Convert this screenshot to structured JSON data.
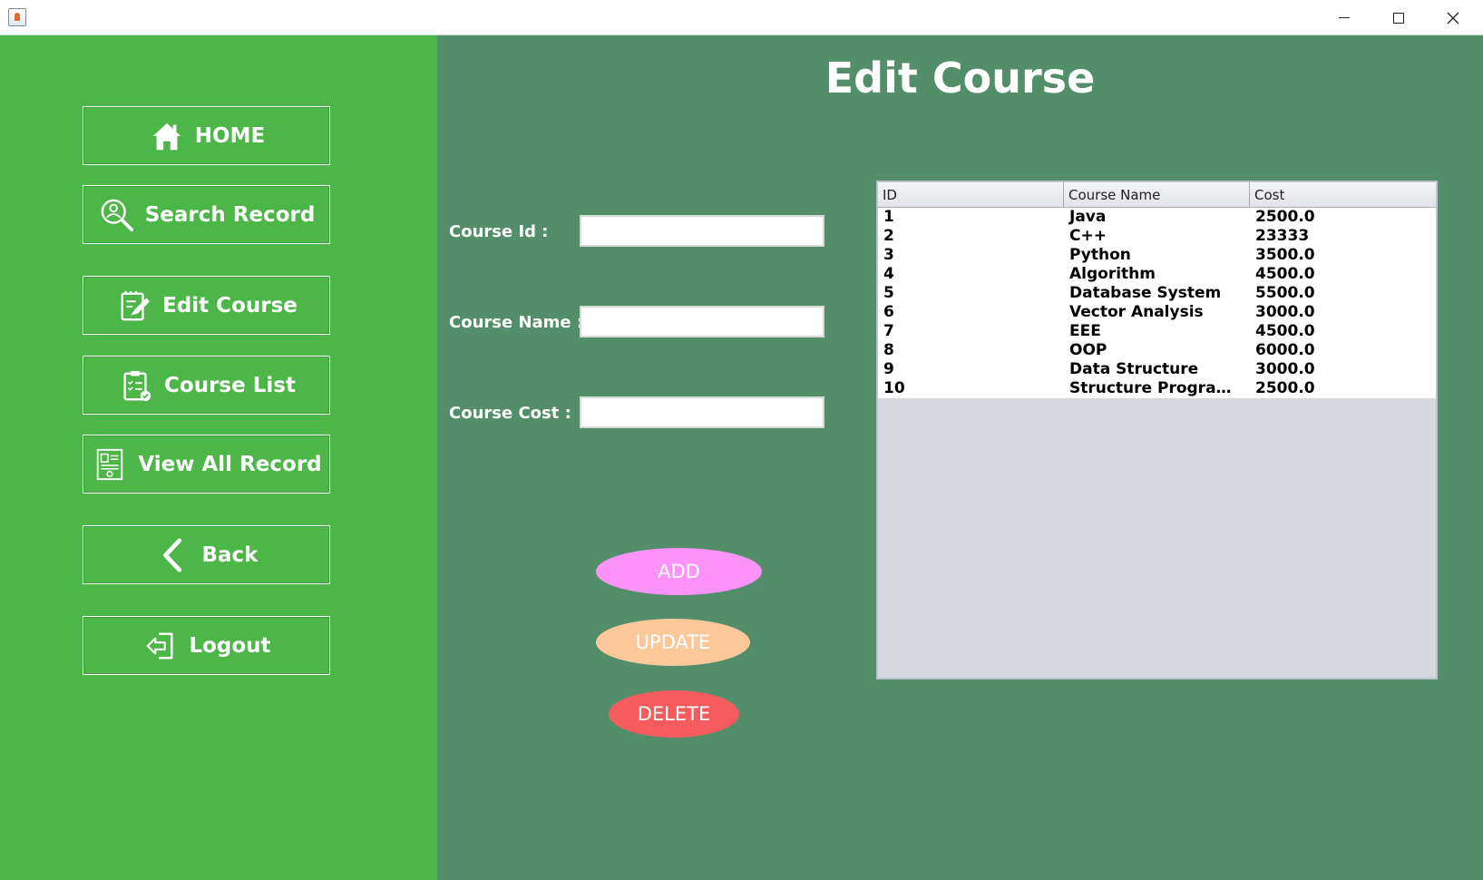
{
  "window": {
    "title": "",
    "icons": {
      "app": "java-app-icon",
      "minimize": "minimize-icon",
      "maximize": "maximize-icon",
      "close": "close-icon"
    }
  },
  "sidebar": {
    "background": "#4db648",
    "items": [
      {
        "label": "HOME",
        "icon": "home-icon"
      },
      {
        "label": "Search Record",
        "icon": "search-user-icon"
      },
      {
        "label": "Edit Course",
        "icon": "edit-document-icon"
      },
      {
        "label": "Course List",
        "icon": "checklist-icon"
      },
      {
        "label": "View All Record",
        "icon": "record-certificate-icon"
      },
      {
        "label": "Back",
        "icon": "chevron-left-icon"
      },
      {
        "label": "Logout",
        "icon": "logout-icon"
      }
    ]
  },
  "main": {
    "background": "#518e69",
    "title": "Edit Course",
    "form": {
      "course_id": {
        "label": "Course Id :",
        "value": ""
      },
      "course_name": {
        "label": "Course Name :",
        "value": ""
      },
      "course_cost": {
        "label": "Course Cost :",
        "value": ""
      }
    },
    "buttons": {
      "add": {
        "label": "ADD",
        "color": "#fd92f8"
      },
      "update": {
        "label": "UPDATE",
        "color": "#fcc89a"
      },
      "delete": {
        "label": "DELETE",
        "color": "#f65b5d"
      }
    },
    "table": {
      "columns": [
        "ID",
        "Course Name",
        "Cost"
      ],
      "rows": [
        [
          "1",
          "Java",
          "2500.0"
        ],
        [
          "2",
          "C++",
          "23333"
        ],
        [
          "3",
          "Python",
          "3500.0"
        ],
        [
          "4",
          "Algorithm",
          "4500.0"
        ],
        [
          "5",
          "Database System",
          "5500.0"
        ],
        [
          "6",
          "Vector Analysis",
          "3000.0"
        ],
        [
          "7",
          "EEE",
          "4500.0"
        ],
        [
          "8",
          "OOP",
          "6000.0"
        ],
        [
          "9",
          "Data Structure",
          "3000.0"
        ],
        [
          "10",
          "Structure Program...",
          "2500.0"
        ]
      ]
    }
  }
}
